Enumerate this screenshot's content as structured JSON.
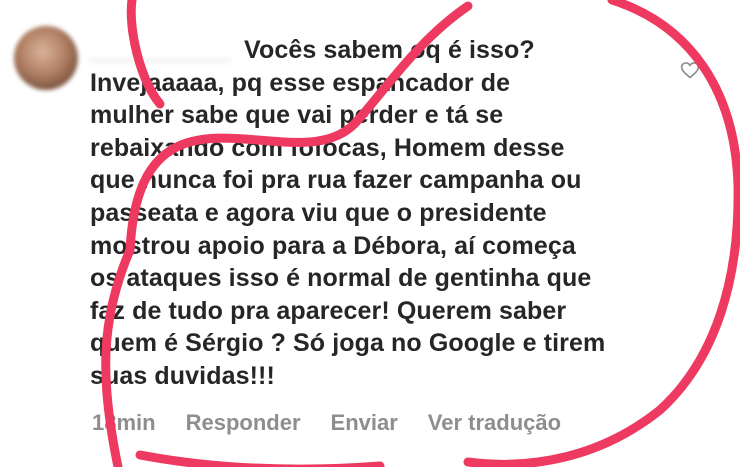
{
  "comment": {
    "username": "__________",
    "text": "Vocês sabem oq é isso?\nInvejaaaaa, pq esse espancador de\nmulher sabe que vai perder e tá se\nrebaixando com fofocas, Homem desse\nque nunca foi pra rua fazer campanha ou\npasseata e agora viu que o presidente\nmostrou apoio para a Débora, aí começa\nos ataques isso é normal de gentinha que\nfaz de tudo pra aparecer! Querem saber\nquem é Sérgio ? Só joga no Google e tirem\nsuas duvidas!!!"
  },
  "actions": {
    "time": "18min",
    "reply": "Responder",
    "send": "Enviar",
    "translate": "Ver tradução"
  },
  "icons": {
    "heart": "heart-icon",
    "avatar": "avatar"
  },
  "colors": {
    "annotation_stroke": "#ee3960",
    "text": "#262626",
    "secondary_text": "#8e8e8e"
  }
}
